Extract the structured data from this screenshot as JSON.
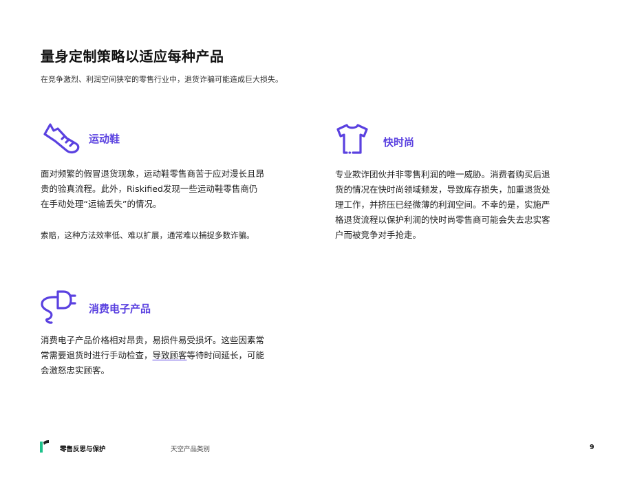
{
  "header": {
    "title": "量身定制策略以适应每种产品",
    "subtitle": "在竞争激烈、利润空间狭窄的零售行业中，退货诈骗可能造成巨大损失。"
  },
  "sneakers": {
    "icon": "sneaker-icon",
    "title": "运动鞋",
    "paragraph": "面对频繁的假冒退货现象，运动鞋零售商苦于应对漫长且昂贵的验真流程。此外，Riskified发现一些运动鞋零售商仍在手动处理“运输丢失”的情况。",
    "paragraph_lines": [
      "面对频繁的假冒退货现象，运动鞋零售商苦于应对漫长且昂",
      "贵的验真流程。此外，Riskified发现一些运动鞋零售商仍",
      "在手动处理“运输丢失”的情况。"
    ],
    "note": "索赔，这种方法效率低、难以扩展，通常难以捕捉多数诈骗。"
  },
  "fast_fashion": {
    "icon": "tshirt-icon",
    "title": "快时尚",
    "paragraph_lines": [
      "专业欺诈团伙并非零售利润的唯一威胁。消费者购买后退",
      "货的情况在快时尚领域频发，导致库存损失，加重退货处",
      "理工作，并挤压已经微薄的利润空间。不幸的是，实施严",
      "格退货流程以保护利润的快时尚零售商可能会失去忠实客",
      "户而被竞争对手抢走。"
    ]
  },
  "electronics": {
    "icon": "plug-icon",
    "title": "消费电子产品",
    "line1": "消费电子产品价格相对昂贵，易损件易受损坏。这些因素常",
    "line2_pre": "常需要退货时进行手动检查，",
    "line2_link": "导致顾客",
    "line2_post": "等待时间延长，可能",
    "line3": "会激怒忠实顾客。"
  },
  "footer": {
    "brand": "零售反思与保护",
    "section": "天空产品类别",
    "page": "9"
  },
  "colors": {
    "accent": "#5a41e0",
    "logo_green": "#1ec28b"
  }
}
